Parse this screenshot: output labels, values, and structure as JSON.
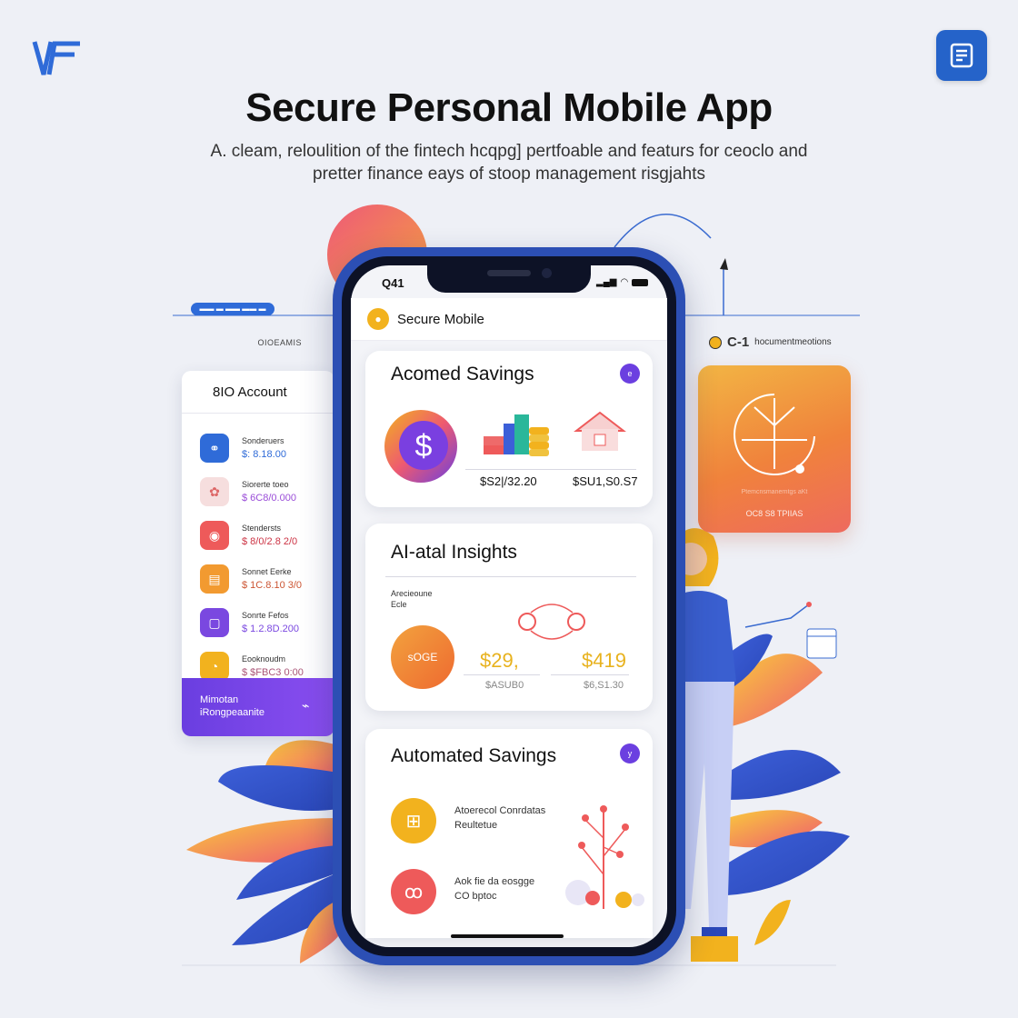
{
  "header": {
    "title": "Secure Personal Mobile App",
    "subtitle": "A. cleam, reloulition of the fintech hcqpg] pertfoable and featurs for ceoclo and pretter finance eays of stoop management risgjahts"
  },
  "decor": {
    "pill_text": "▬▬ ▬ ▬▬ ▬▬ ▬",
    "left_label": "OIOEAMIS",
    "right_label_code": "C-1",
    "right_label_text": "hocumentmeotions"
  },
  "account_card": {
    "title": "8IO Account",
    "items": [
      {
        "name": "Sonderuers",
        "value": "$: 8.18.00",
        "color": "#2f6bd8",
        "value_color": "#2f6bd8",
        "icon": "link-icon"
      },
      {
        "name": "Siorerte toeo",
        "value": "$ 6C8/0.000",
        "color": "#f6dede",
        "value_color": "#9a4dd8",
        "icon": "flower-icon"
      },
      {
        "name": "Stendersts",
        "value": "$ 8/0/2.8 2/0",
        "color": "#ee5a5a",
        "value_color": "#cc3344",
        "icon": "tag-icon"
      },
      {
        "name": "Sonnet Eerke",
        "value": "$ 1C.8.10 3/0",
        "color": "#f29a30",
        "value_color": "#cc5533",
        "icon": "doc-icon"
      },
      {
        "name": "Sonrte Fefos",
        "value": "$ 1.2.8D.200",
        "color": "#7a48e0",
        "value_color": "#7a48e0",
        "icon": "square-icon"
      },
      {
        "name": "Eooknoudm",
        "value": "$ $FBC3 0:00",
        "color": "#f2b21e",
        "value_color": "#aa5577",
        "icon": "chat-icon"
      }
    ],
    "footer_line1": "Mimotan",
    "footer_line2": "iRongpeaanite"
  },
  "orange_card": {
    "caption": "Ptemcnsmanerntgs aKt",
    "sub": "OC8 S8 TPIIAS"
  },
  "phone": {
    "time": "Q41",
    "app_name": "Secure Mobile",
    "card1": {
      "title": "Acomed Savings",
      "badge": "e",
      "value_a": "$S2|/32.20",
      "value_b": "$SU1,S0.S7"
    },
    "card2": {
      "title": "AI-atal Insights",
      "small_label_1": "Arecieoune",
      "small_label_2": "Ecle",
      "circle_text": "sOGE",
      "big_a": "$29,",
      "big_b": "$419",
      "sub_a": "$ASUB0",
      "sub_b": "$6,S1.30"
    },
    "card3": {
      "title": "Automated Savings",
      "badge": "y",
      "item1_line1": "Atoerecol Conrdatas",
      "item1_line2": "Reultetue",
      "item2_line1": "Aok fie da eosgge",
      "item2_line2": "CO bptoc"
    }
  },
  "colors": {
    "brand_blue": "#2c4fb4",
    "accent_purple": "#6b3fe0",
    "accent_yellow": "#f2b21e",
    "accent_orange": "#f0823c"
  }
}
